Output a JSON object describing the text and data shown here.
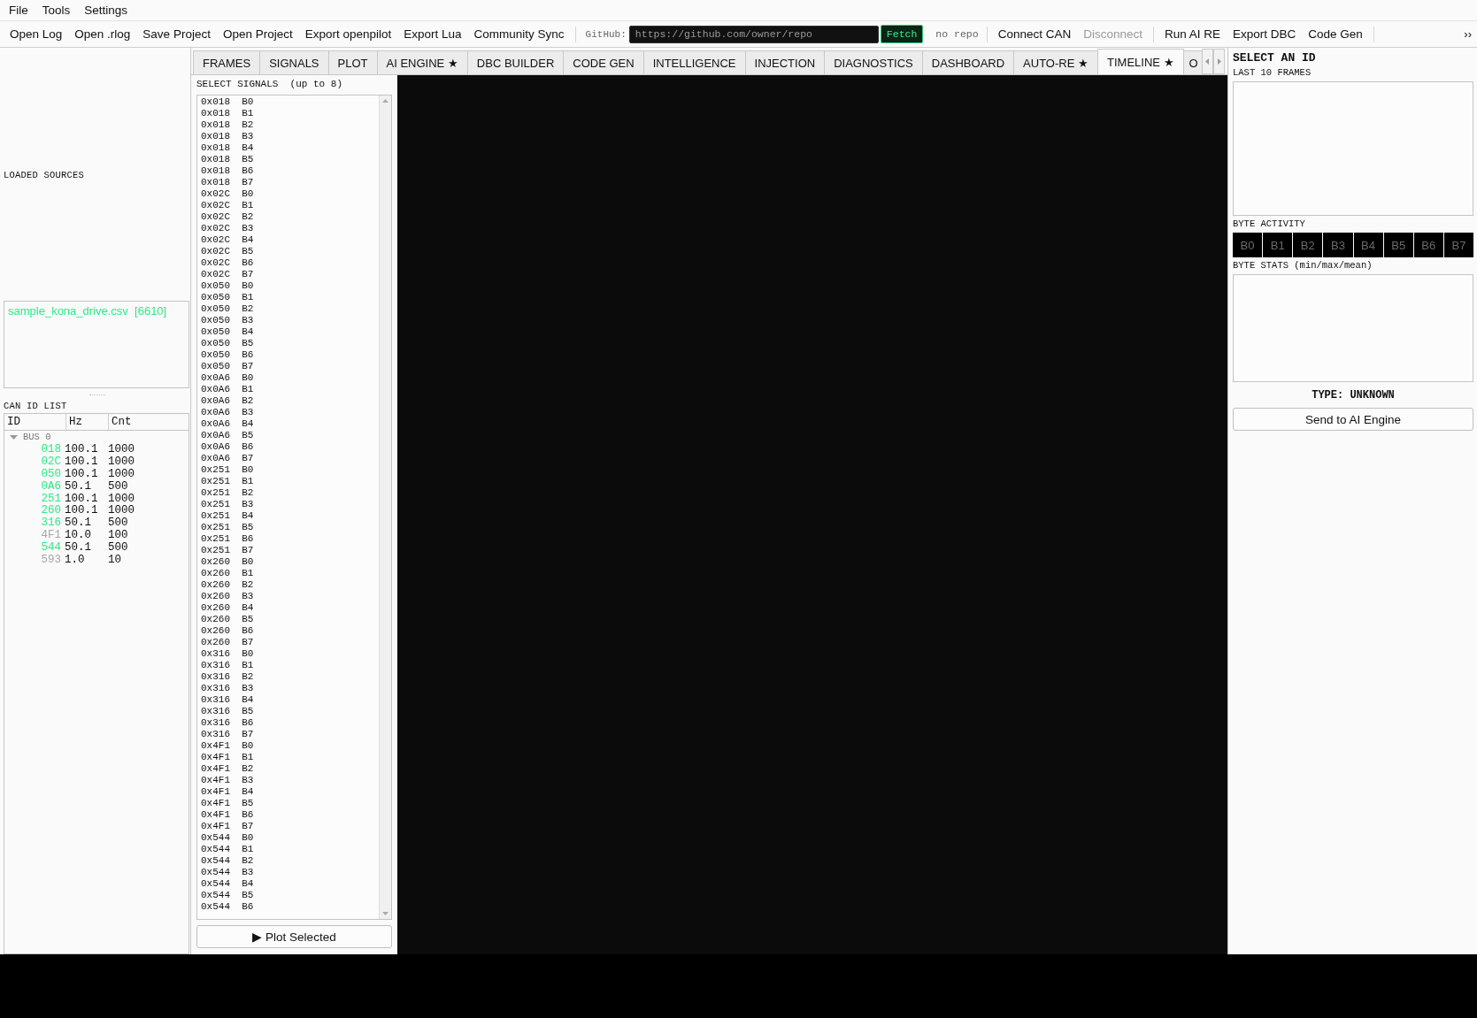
{
  "menu": [
    "File",
    "Tools",
    "Settings"
  ],
  "toolbar": {
    "file_actions": [
      "Open Log",
      "Open .rlog",
      "Save Project",
      "Open Project",
      "Export openpilot",
      "Export Lua",
      "Community Sync"
    ],
    "github": {
      "label": "GitHub:",
      "placeholder": "https://github.com/owner/repo",
      "fetch_button": "Fetch",
      "status": "no repo"
    },
    "can_actions": [
      {
        "label": "Connect CAN",
        "disabled": false
      },
      {
        "label": "Disconnect",
        "disabled": true
      }
    ],
    "tool_actions": [
      "Run AI RE",
      "Export DBC",
      "Code Gen"
    ],
    "overflow": "››"
  },
  "tabs": [
    {
      "label": "FRAMES",
      "selected": false
    },
    {
      "label": "SIGNALS",
      "selected": false
    },
    {
      "label": "PLOT",
      "selected": false
    },
    {
      "label": "AI ENGINE ★",
      "selected": false
    },
    {
      "label": "DBC BUILDER",
      "selected": false
    },
    {
      "label": "CODE GEN",
      "selected": false
    },
    {
      "label": "INTELLIGENCE",
      "selected": false
    },
    {
      "label": "INJECTION",
      "selected": false
    },
    {
      "label": "DIAGNOSTICS",
      "selected": false
    },
    {
      "label": "DASHBOARD",
      "selected": false
    },
    {
      "label": "AUTO-RE ★",
      "selected": false
    },
    {
      "label": "TIMELINE ★",
      "selected": true
    },
    {
      "label": "O",
      "selected": false
    }
  ],
  "left_panel": {
    "loaded_sources": {
      "title": "LOADED SOURCES",
      "items": [
        "sample_kona_drive.csv  [6610]"
      ]
    },
    "can_id_list": {
      "title": "CAN ID LIST",
      "columns": [
        "ID",
        "Hz",
        "Cnt"
      ],
      "bus": {
        "label": "BUS 0",
        "expanded": true,
        "rows": [
          {
            "id": "018",
            "hz": "100.1",
            "cnt": "1000",
            "color": "#2ee887"
          },
          {
            "id": "02C",
            "hz": "100.1",
            "cnt": "1000",
            "color": "#2ee887"
          },
          {
            "id": "050",
            "hz": "100.1",
            "cnt": "1000",
            "color": "#2ee887"
          },
          {
            "id": "0A6",
            "hz": "50.1",
            "cnt": "500",
            "color": "#2ee887"
          },
          {
            "id": "251",
            "hz": "100.1",
            "cnt": "1000",
            "color": "#2ee887"
          },
          {
            "id": "260",
            "hz": "100.1",
            "cnt": "1000",
            "color": "#2ee887"
          },
          {
            "id": "316",
            "hz": "50.1",
            "cnt": "500",
            "color": "#2ee887"
          },
          {
            "id": "4F1",
            "hz": "10.0",
            "cnt": "100",
            "color": "#a6a6a6"
          },
          {
            "id": "544",
            "hz": "50.1",
            "cnt": "500",
            "color": "#2ee887"
          },
          {
            "id": "593",
            "hz": "1.0",
            "cnt": "10",
            "color": "#a6a6a6"
          }
        ]
      }
    }
  },
  "signals": {
    "title": "SELECT SIGNALS  (up to 8)",
    "items": [
      "0x018  B0",
      "0x018  B1",
      "0x018  B2",
      "0x018  B3",
      "0x018  B4",
      "0x018  B5",
      "0x018  B6",
      "0x018  B7",
      "0x02C  B0",
      "0x02C  B1",
      "0x02C  B2",
      "0x02C  B3",
      "0x02C  B4",
      "0x02C  B5",
      "0x02C  B6",
      "0x02C  B7",
      "0x050  B0",
      "0x050  B1",
      "0x050  B2",
      "0x050  B3",
      "0x050  B4",
      "0x050  B5",
      "0x050  B6",
      "0x050  B7",
      "0x0A6  B0",
      "0x0A6  B1",
      "0x0A6  B2",
      "0x0A6  B3",
      "0x0A6  B4",
      "0x0A6  B5",
      "0x0A6  B6",
      "0x0A6  B7",
      "0x251  B0",
      "0x251  B1",
      "0x251  B2",
      "0x251  B3",
      "0x251  B4",
      "0x251  B5",
      "0x251  B6",
      "0x251  B7",
      "0x260  B0",
      "0x260  B1",
      "0x260  B2",
      "0x260  B3",
      "0x260  B4",
      "0x260  B5",
      "0x260  B6",
      "0x260  B7",
      "0x316  B0",
      "0x316  B1",
      "0x316  B2",
      "0x316  B3",
      "0x316  B4",
      "0x316  B5",
      "0x316  B6",
      "0x316  B7",
      "0x4F1  B0",
      "0x4F1  B1",
      "0x4F1  B2",
      "0x4F1  B3",
      "0x4F1  B4",
      "0x4F1  B5",
      "0x4F1  B6",
      "0x4F1  B7",
      "0x544  B0",
      "0x544  B1",
      "0x544  B2",
      "0x544  B3",
      "0x544  B4",
      "0x544  B5",
      "0x544  B6"
    ],
    "plot_button": {
      "icon": "▶",
      "label": "Plot Selected"
    }
  },
  "right_panel": {
    "title": "SELECT AN ID",
    "last_frames_label": "LAST 10 FRAMES",
    "byte_activity": {
      "label": "BYTE ACTIVITY",
      "bytes": [
        "B0",
        "B1",
        "B2",
        "B3",
        "B4",
        "B5",
        "B6",
        "B7"
      ]
    },
    "byte_stats_label": "BYTE STATS (min/max/mean)",
    "type_label": "TYPE: UNKNOWN",
    "send_button": "Send to AI Engine"
  }
}
